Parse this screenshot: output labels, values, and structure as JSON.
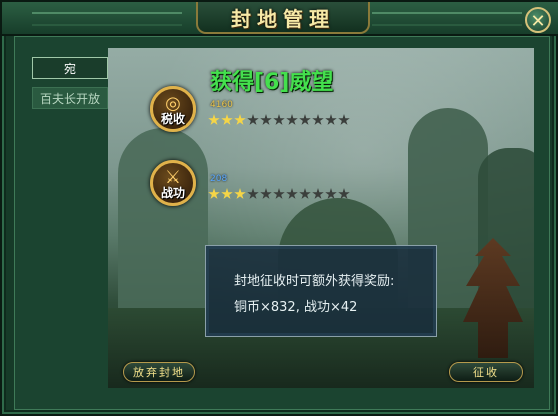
{
  "window": {
    "title": "封地管理",
    "close_icon": "close-x-icon"
  },
  "tabs": [
    {
      "label": "宛",
      "active": true
    },
    {
      "label": "百夫长开放",
      "active": false
    }
  ],
  "reward": {
    "title": "获得[6]威望"
  },
  "rows": [
    {
      "icon": "coins-icon",
      "label": "税收",
      "value": "4160",
      "stars_filled": 3,
      "stars_total": 11
    },
    {
      "icon": "crossed-swords-icon",
      "label": "战功",
      "value": "208",
      "stars_filled": 3,
      "stars_total": 11
    }
  ],
  "info": {
    "line1": "封地征收时可额外获得奖励:",
    "line2": "铜币×832, 战功×42"
  },
  "buttons": {
    "abandon": "放弃封地",
    "collect": "征收"
  },
  "colors": {
    "frame": "#163a28",
    "title_text": "#f6e9a6",
    "reward_text": "#44e04d",
    "tax_value": "#e8c24a",
    "merit_value": "#59a7ff",
    "star_on": "#f5d547",
    "star_off": "#3b3f3c"
  }
}
